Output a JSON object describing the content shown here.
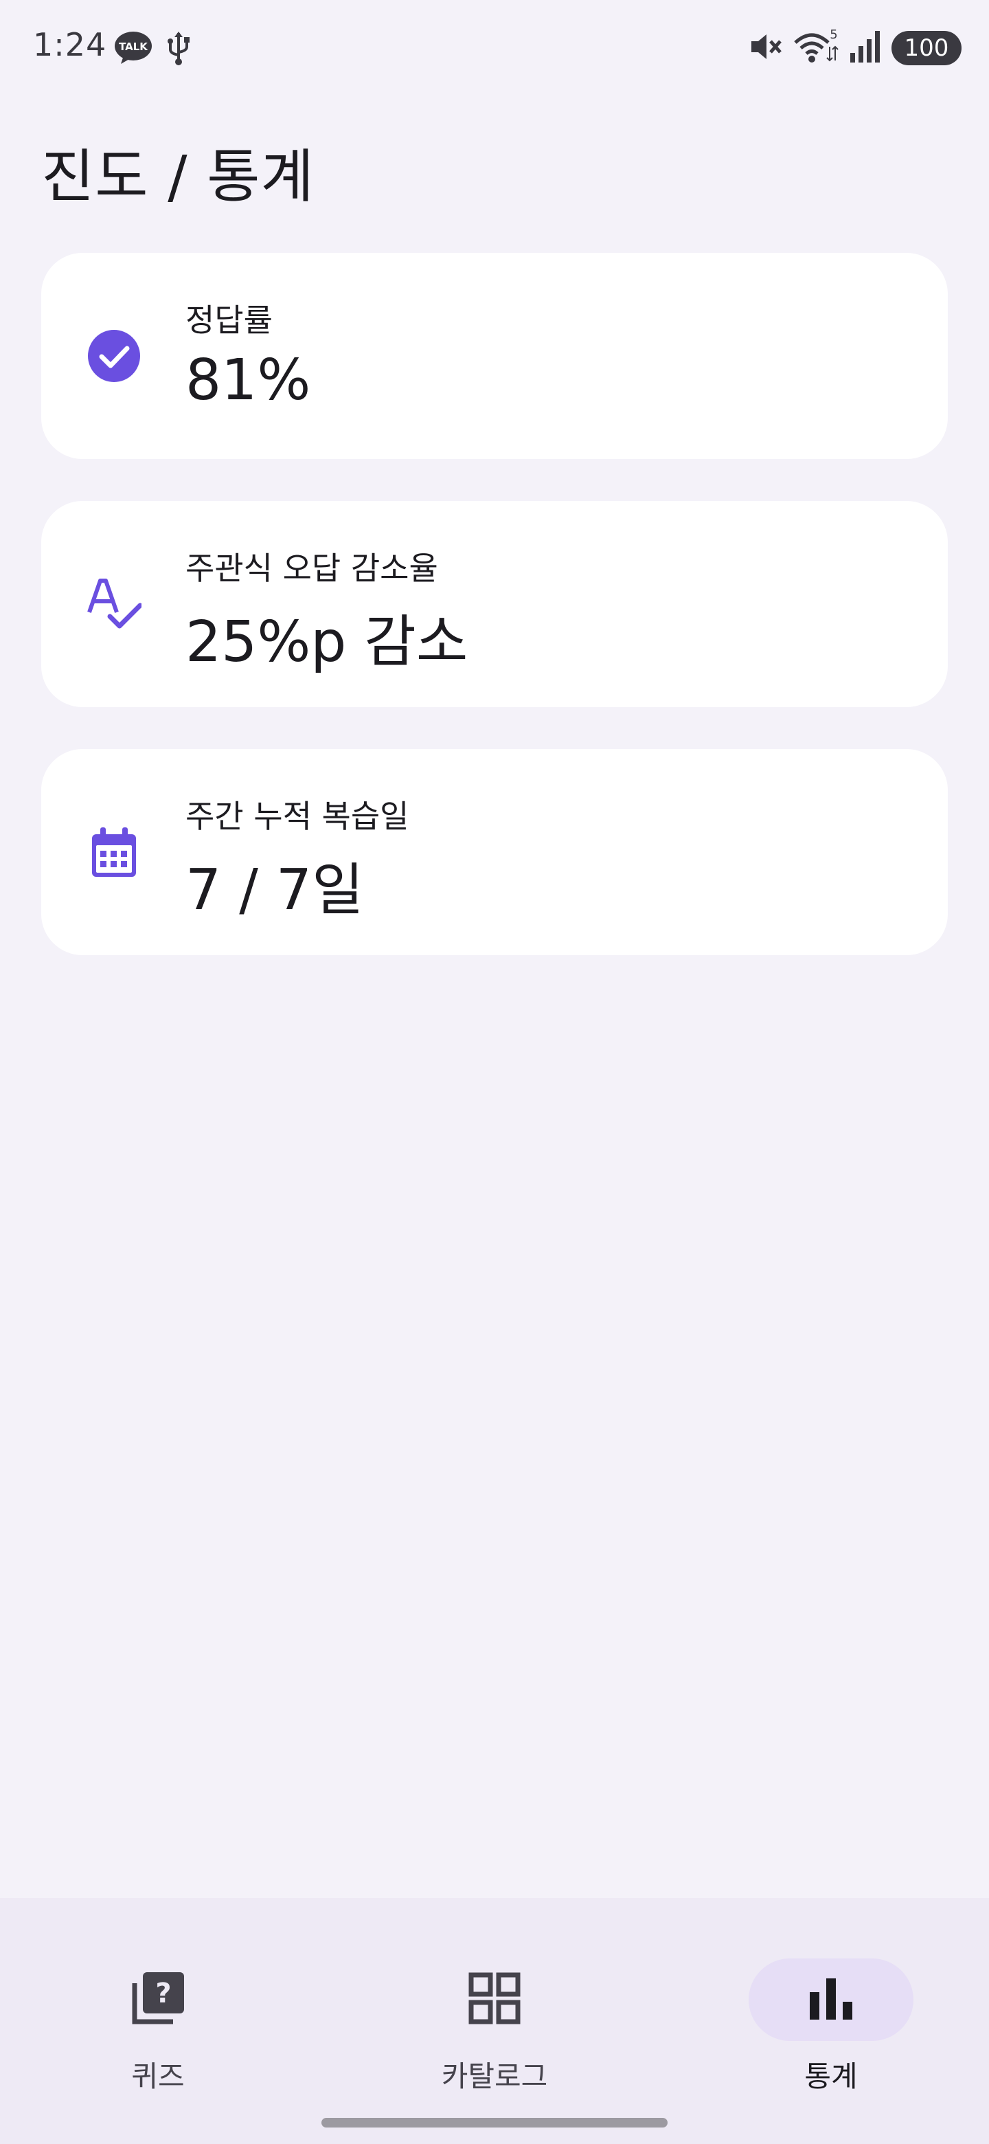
{
  "status_bar": {
    "time": "1:24",
    "left_icons": [
      "kakaotalk-icon",
      "usb-icon"
    ],
    "right_icons": [
      "mute-icon",
      "wifi-icon",
      "signal-icon"
    ],
    "talk_badge": "TALK",
    "wifi_badge": "5",
    "battery": "100"
  },
  "page": {
    "title": "진도 / 통계"
  },
  "cards": [
    {
      "icon": "check-circle-icon",
      "label": "정답률",
      "value": "81%"
    },
    {
      "icon": "spellcheck-icon",
      "label": "주관식 오답 감소율",
      "value": "25%p 감소"
    },
    {
      "icon": "calendar-icon",
      "label": "주간 누적 복습일",
      "value": "7 / 7일"
    }
  ],
  "bottom_nav": {
    "items": [
      {
        "icon": "quiz-icon",
        "label": "퀴즈",
        "active": false
      },
      {
        "icon": "grid-icon",
        "label": "카탈로그",
        "active": false
      },
      {
        "icon": "bar-chart-icon",
        "label": "통계",
        "active": true
      }
    ]
  },
  "colors": {
    "background": "#f4f2f9",
    "card": "#ffffff",
    "accent": "#6a4fe0",
    "nav_background": "#eeeaf5",
    "nav_active_pill": "#e6def6"
  }
}
